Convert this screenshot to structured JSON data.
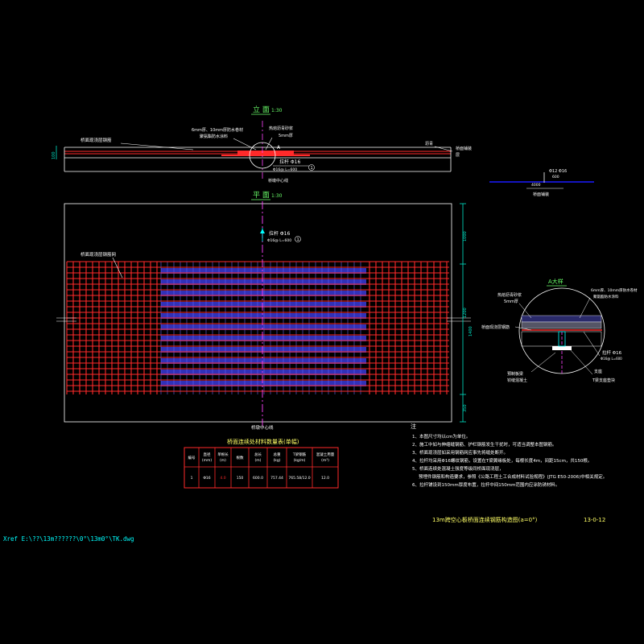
{
  "colors": {
    "background": "#000000",
    "outline": "#ffffff",
    "rebar": "#ff2a2a",
    "mesh_center": "#3a3ad8",
    "centerline": "#ff44ff",
    "dimension": "#00e5c8",
    "text_yellow": "#ffff66",
    "text_cyan": "#00ffff",
    "text_green": "#6aff6a",
    "deck_line": "#1a1aff"
  },
  "elevation": {
    "title": "立 面",
    "scale": "1:30",
    "label_left": "桥面现浇层钢筋",
    "label_center_top_1": "6mm厚、10mm厚防水卷材",
    "label_center_top_2": "聚氨酯防水涂料",
    "label_center_right_1": "热熔沥青砂浆",
    "label_center_right_2": "5mm厚",
    "label_right_top": "沥青",
    "label_right_1": "桥面铺装",
    "label_right_2": "层",
    "detail_mark": "A",
    "rebar_label": "拉杆 Φ16",
    "rebar_sub": "Φ16@ L=600",
    "circle_ref": "1",
    "center_label": "桥墩中心线",
    "dim_left": "100"
  },
  "small_detail": {
    "dim": "4000",
    "label": "Φ12 Φ16",
    "sub": "600",
    "note": "桥面铺装"
  },
  "plan": {
    "title": "平 面",
    "scale": "1:30",
    "rebar_label": "拉杆 Φ16",
    "rebar_sub": "Φ16@ L=600",
    "circle_ref": "1",
    "mesh_label": "桥面现浇层钢筋网",
    "center_label": "桥墩中心线",
    "dims_right": [
      "1000",
      "1200",
      "1400",
      "350"
    ]
  },
  "detail_a": {
    "title": "A大样",
    "label_1": "热熔沥青砂浆",
    "label_2": "5mm厚",
    "label_3": "桥面现浇层钢筋",
    "label_right_1": "6mm厚、10mm厚防水卷材",
    "label_right_2": "聚氨酯防水涂料",
    "rebar_label": "拉杆 Φ16",
    "rebar_sub": "Φ16@ L=600",
    "bottom_left_1": "预制板梁",
    "bottom_left_2": "铰缝混凝土",
    "bottom_right_1": "支座",
    "bottom_right_2": "T梁支座垫块"
  },
  "table": {
    "title": "桥面连续处材料数量表(单幅)",
    "headers": [
      "编号",
      "直径\n(mm)",
      "单根长\n(m)",
      "根数",
      "总长\n(m)",
      "总重\n(kg)",
      "T梁钢筋\n(kg/m)",
      "混凝土用量\n(m³)"
    ],
    "rows": [
      [
        "1",
        "Φ16",
        "4.0",
        "150",
        "600.0",
        "757.44",
        "765.58/12.0",
        "12.0"
      ]
    ]
  },
  "notes": {
    "heading": "注",
    "items": [
      "1、本图尺寸均以cm为单位。",
      "2、施工中如与伸缩缝钢筋、护栏钢筋发生干扰时，可适当调整本图钢筋。",
      "3、桥面现浇层如采用钢筋网应事先将缝处断开。",
      "4、拉杆均采用Φ16螺纹钢筋，设置在T梁翼缘板处，每根长度4m，间距15cm，共150根。",
      "5、桥面连续处混凝土强度等级同桥面现浇层，预埋件钢筋和构造要求，参照《公路工程土工合成材料试验规程》(JTG E50-2006)中相关规定。",
      "6、拉杆铺设到150mm厚度布置，拉杆中间150mm范围内应涂防锈材料。"
    ]
  },
  "title_block": {
    "drawing_title": "13m跨空心板桥面连续钢筋构造图(a=0°)",
    "drawing_number": "13-0-12"
  },
  "xref": "Xref  E:\\??\\13m??????\\0°\\13m0°\\TK.dwg"
}
